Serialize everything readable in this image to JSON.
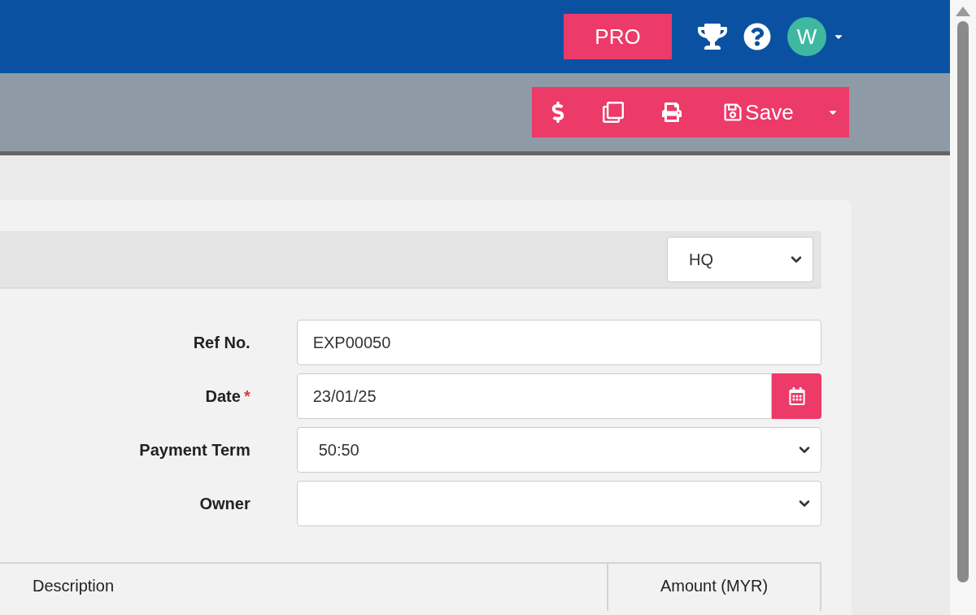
{
  "topbar": {
    "plan_badge": "PRO",
    "avatar_initial": "W"
  },
  "toolbar": {
    "save_label": "Save"
  },
  "branch_select": {
    "value": "HQ"
  },
  "form": [
    {
      "kind": "text",
      "label": "Ref No.",
      "value": "EXP00050"
    },
    {
      "kind": "date",
      "label": "Date",
      "value": "23/01/25",
      "required_mark": "*"
    },
    {
      "kind": "select",
      "label": "Payment Term",
      "value": "50:50"
    },
    {
      "kind": "select",
      "label": "Owner"
    }
  ],
  "table": {
    "columns": [
      "Description",
      "Amount (MYR)"
    ]
  }
}
